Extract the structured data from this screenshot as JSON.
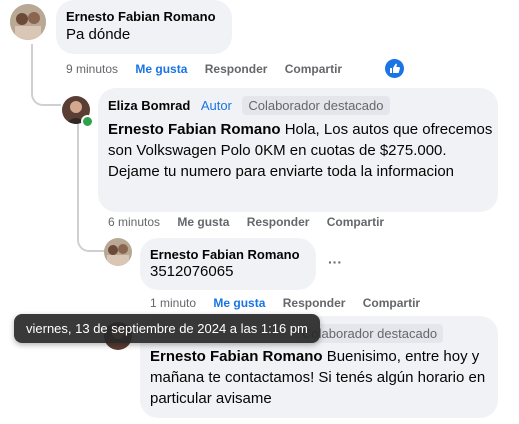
{
  "comments": [
    {
      "author": "Ernesto Fabian Romano",
      "text": "Pa dónde",
      "time": "9 minutos",
      "like": "Me gusta",
      "reply": "Responder",
      "share": "Compartir"
    },
    {
      "author": "Eliza Bomrad",
      "role": "Autor",
      "badge": "Colaborador destacado",
      "mention": "Ernesto Fabian Romano",
      "text": " Hola, Los autos que ofrecemos son Volkswagen Polo 0KM en cuotas de $275.000. Dejame tu numero para enviarte toda la informacion",
      "time": "6 minutos",
      "like": "Me gusta",
      "reply": "Responder",
      "share": "Compartir"
    },
    {
      "author": "Ernesto Fabian Romano",
      "text": "3512076065",
      "more": "···",
      "time": "1 minuto",
      "like": "Me gusta",
      "reply": "Responder",
      "share": "Compartir"
    },
    {
      "badge": "Colaborador destacado",
      "mention": "Ernesto Fabian Romano",
      "text": " Buenisimo, entre hoy y mañana te contactamos! Si tenés algún horario en particular avisame"
    }
  ],
  "tooltip": "viernes, 13 de septiembre de 2024 a las 1:16 pm",
  "colors": {
    "accent": "#1b74e4",
    "bubble": "#f0f2f5",
    "online": "#31a24c"
  }
}
